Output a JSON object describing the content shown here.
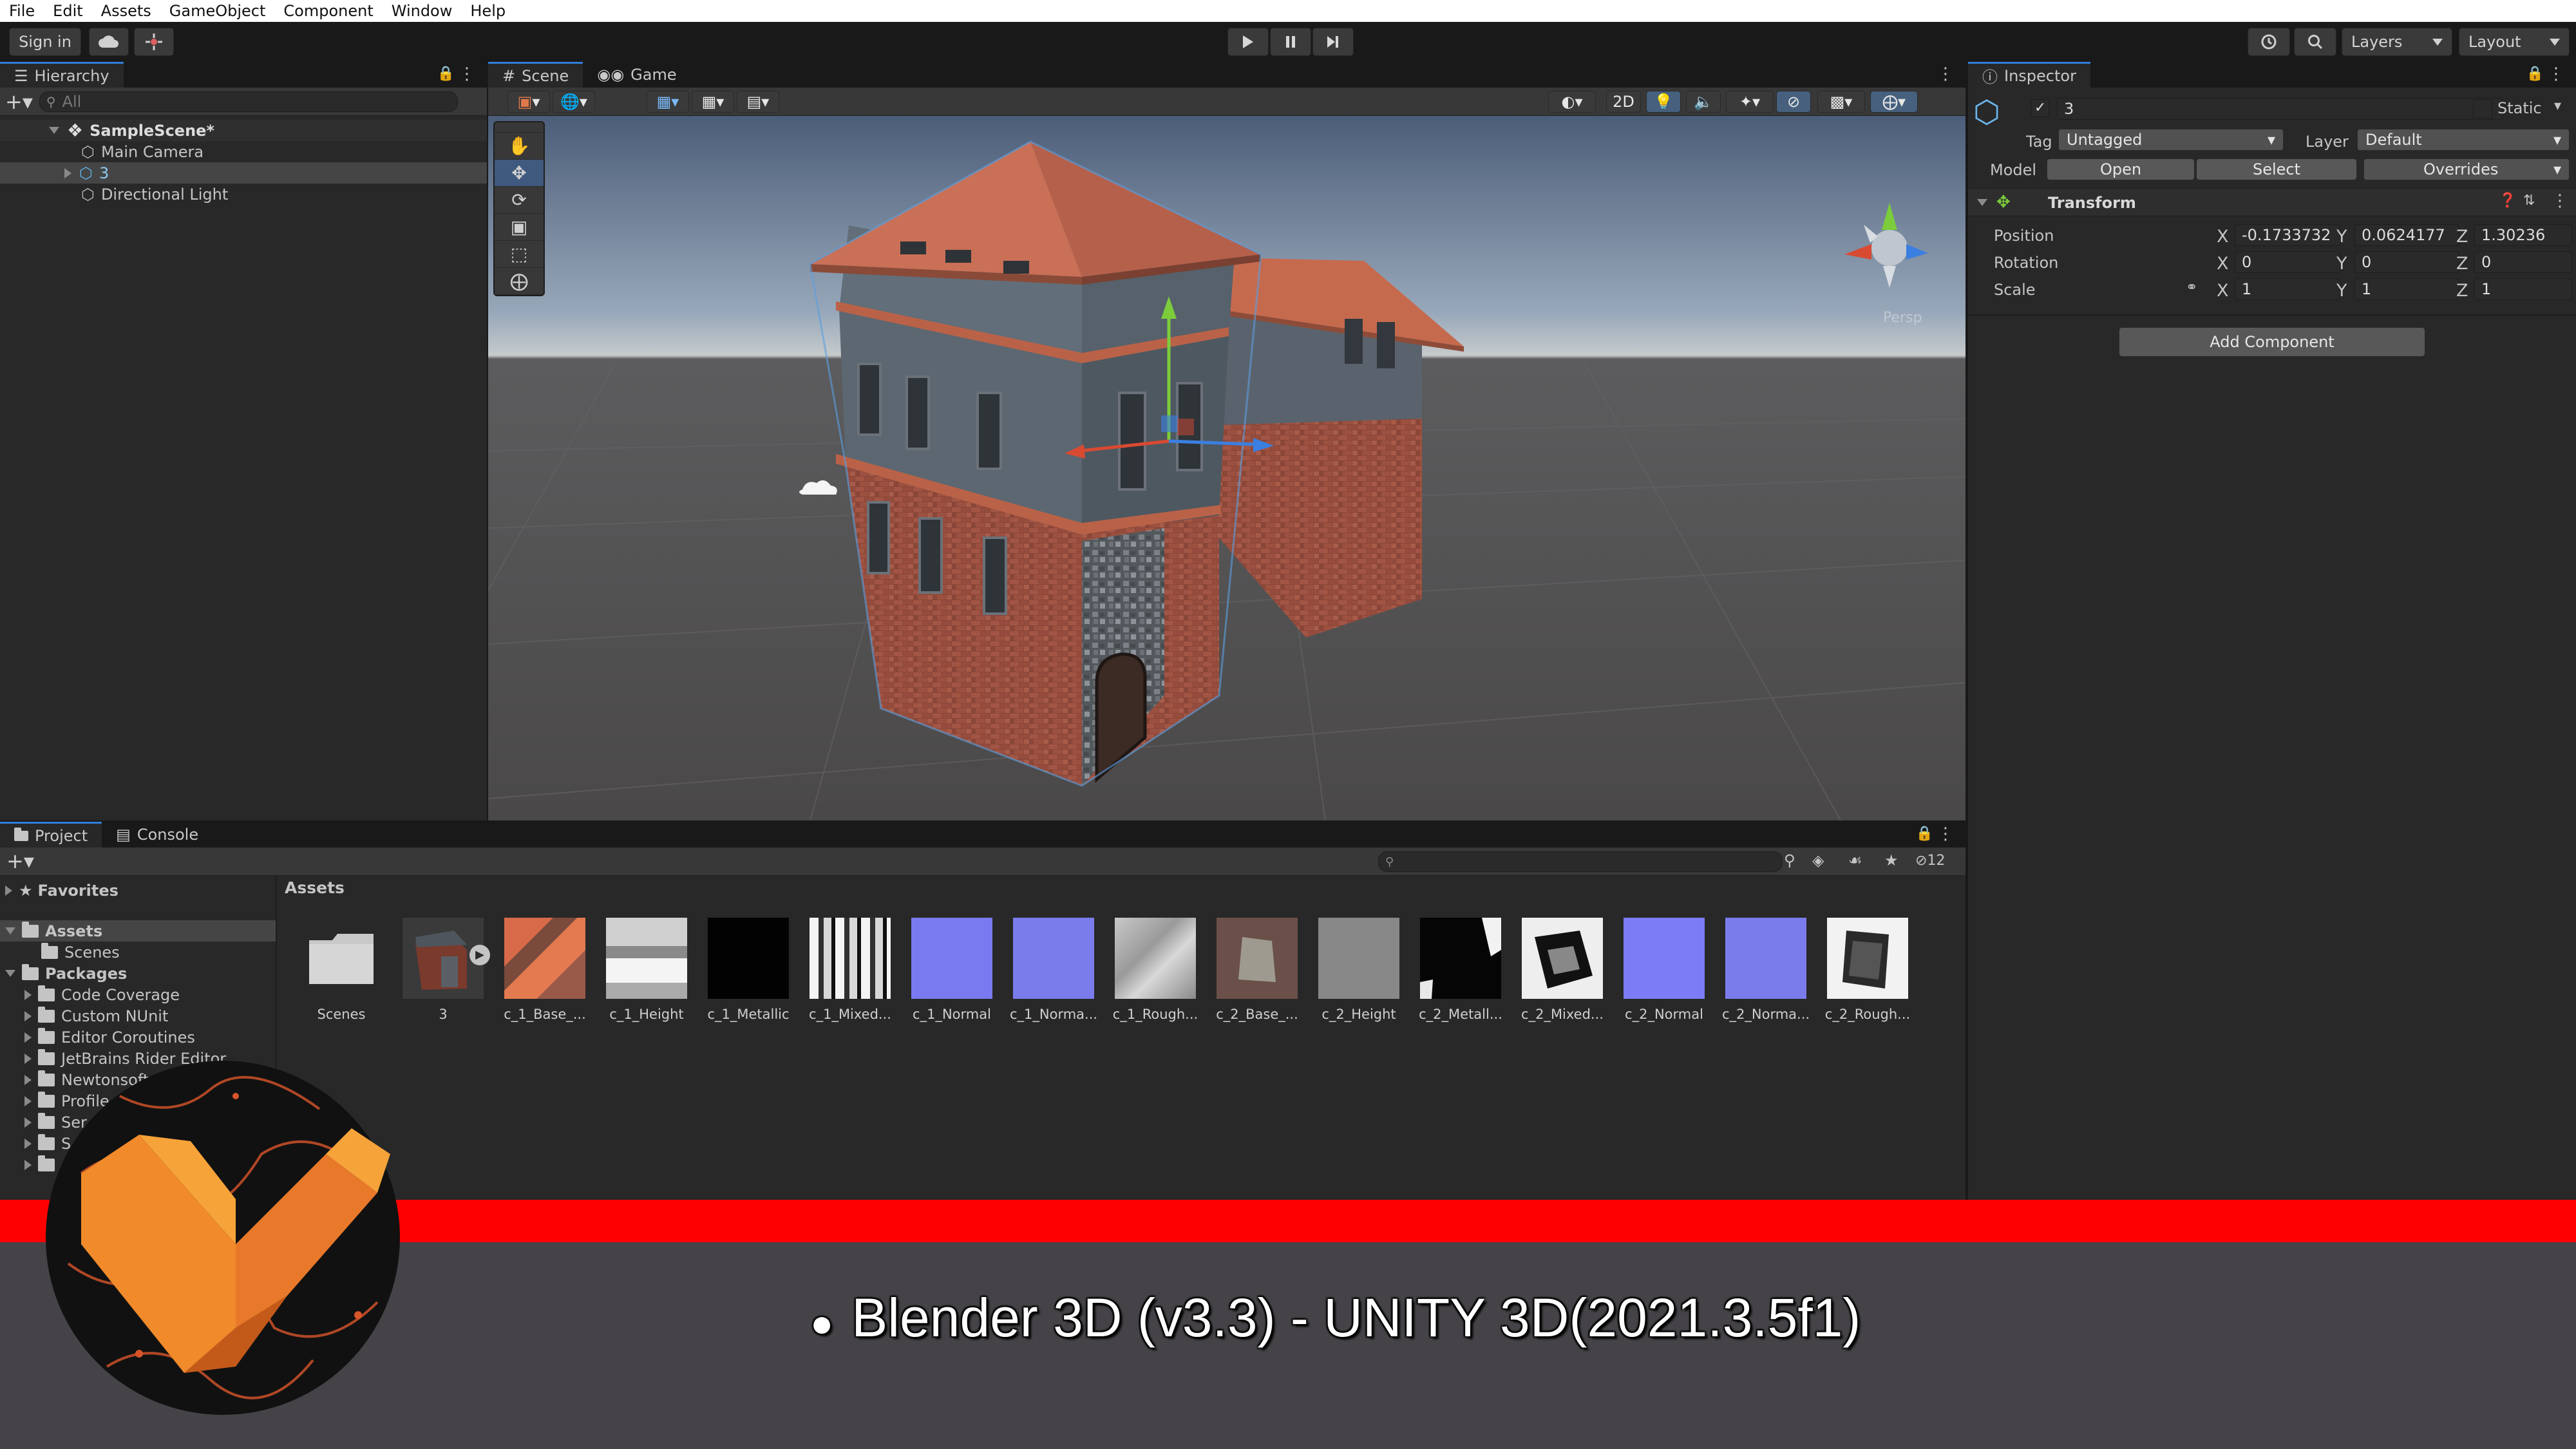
{
  "menu": [
    "File",
    "Edit",
    "Assets",
    "GameObject",
    "Component",
    "Window",
    "Help"
  ],
  "toolbar": {
    "sign_in": "Sign in",
    "layers": "Layers",
    "layout": "Layout"
  },
  "hierarchy": {
    "tab": "Hierarchy",
    "search_placeholder": "All",
    "scene": "SampleScene*",
    "items": [
      "Main Camera",
      "3",
      "Directional Light"
    ]
  },
  "scene_view": {
    "tabs": [
      "Scene",
      "Game"
    ],
    "mode_2d": "2D",
    "gizmo_label": "Persp"
  },
  "inspector": {
    "tab": "Inspector",
    "object_name": "3",
    "static_label": "Static",
    "tag_label": "Tag",
    "tag_value": "Untagged",
    "layer_label": "Layer",
    "layer_value": "Default",
    "model_label": "Model",
    "open": "Open",
    "select": "Select",
    "overrides": "Overrides",
    "transform": "Transform",
    "position_label": "Position",
    "rotation_label": "Rotation",
    "scale_label": "Scale",
    "axis": [
      "X",
      "Y",
      "Z"
    ],
    "position": [
      "-0.1733732",
      "0.0624177",
      "1.30236"
    ],
    "rotation": [
      "0",
      "0",
      "0"
    ],
    "scale": [
      "1",
      "1",
      "1"
    ],
    "add_component": "Add Component"
  },
  "project": {
    "tabs": [
      "Project",
      "Console"
    ],
    "hidden_count": "12",
    "favorites": "Favorites",
    "assets_root": "Assets",
    "assets_children": [
      "Scenes"
    ],
    "packages": "Packages",
    "package_items": [
      "Code Coverage",
      "Custom NUnit",
      "Editor Coroutines",
      "JetBrains Rider Editor",
      "Newtonsoft",
      "Profile",
      "Ser",
      "S",
      "",
      ""
    ],
    "breadcrumb": "Assets",
    "assets": [
      "Scenes",
      "3",
      "c_1_Base_...",
      "c_1_Height",
      "c_1_Metallic",
      "c_1_Mixed...",
      "c_1_Normal",
      "c_1_Norma...",
      "c_1_Rough...",
      "c_2_Base_...",
      "c_2_Height",
      "c_2_Metall...",
      "c_2_Mixed...",
      "c_2_Normal",
      "c_2_Norma...",
      "c_2_Rough..."
    ]
  },
  "banner": {
    "text": "Blender 3D (v3.3) - UNITY 3D(2021.3.5f1)"
  }
}
